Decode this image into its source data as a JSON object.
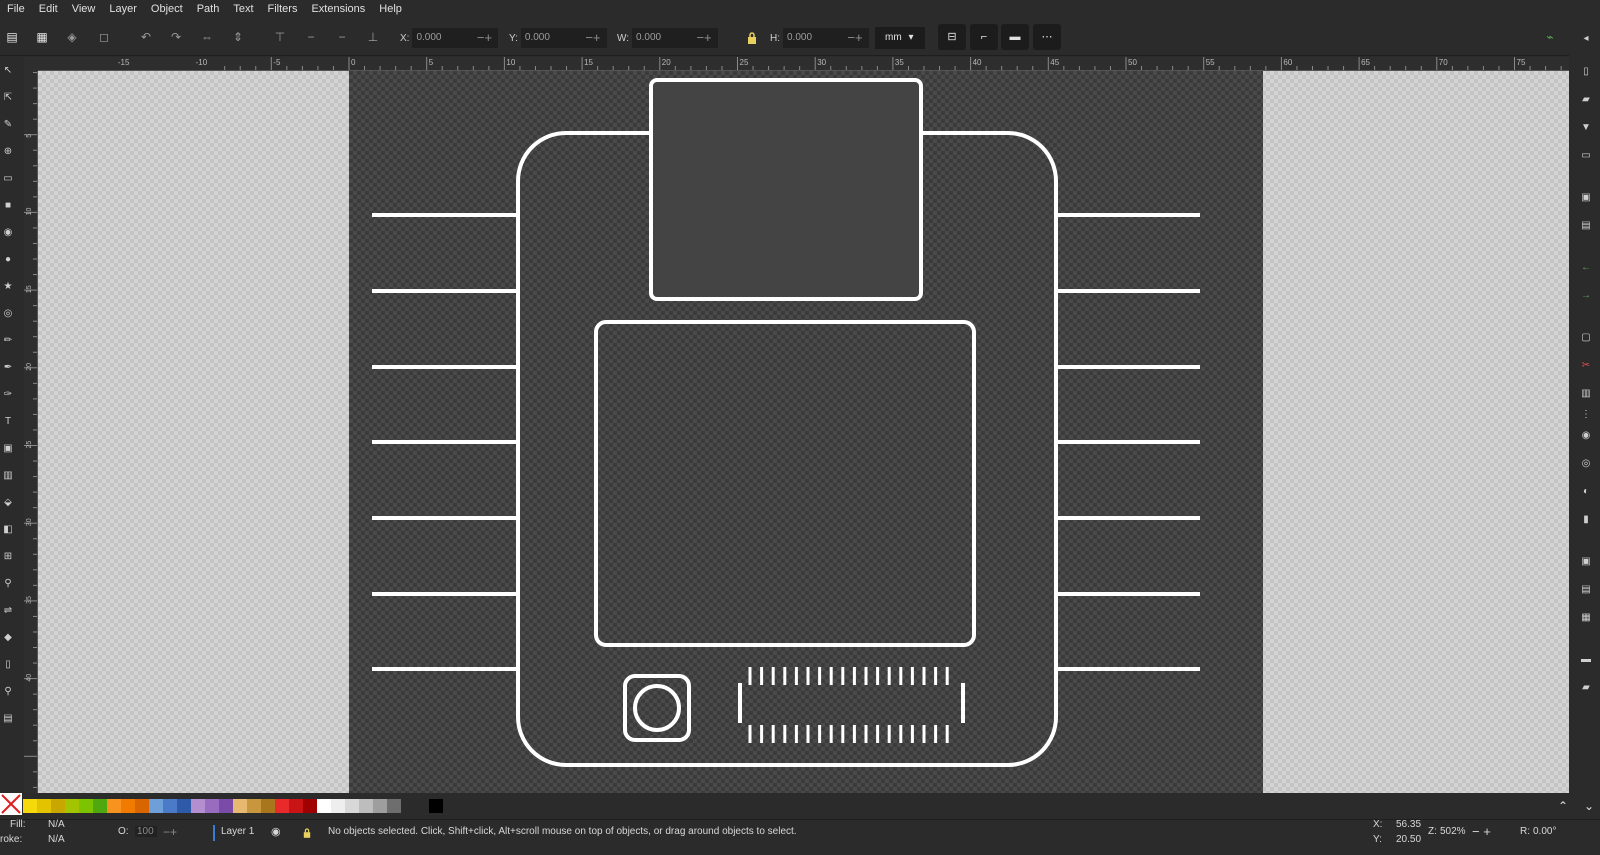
{
  "menu": [
    "File",
    "Edit",
    "View",
    "Layer",
    "Object",
    "Path",
    "Text",
    "Filters",
    "Extensions",
    "Help"
  ],
  "controls": {
    "x_label": "X:",
    "x_value": "0.000",
    "y_label": "Y:",
    "y_value": "0.000",
    "w_label": "W:",
    "w_value": "0.000",
    "h_label": "H:",
    "h_value": "0.000",
    "unit": "mm"
  },
  "ruler": {
    "h_ticks": [
      "-15",
      "-10",
      "-5",
      "0",
      "5",
      "10",
      "15",
      "20",
      "25",
      "30",
      "35",
      "40",
      "45",
      "50",
      "55",
      "60",
      "65",
      "70",
      "75"
    ],
    "v_ticks": [
      "5",
      "10",
      "15",
      "20",
      "25",
      "30",
      "35",
      "40"
    ]
  },
  "palette": {
    "colors": [
      "#f5d90a",
      "#e3c300",
      "#c8a800",
      "#a3c400",
      "#7cc400",
      "#4ea80e",
      "#f7931e",
      "#f07b00",
      "#d86500",
      "#6f9fd8",
      "#4a7ac8",
      "#2f5aa8",
      "#b48fd0",
      "#9a6cbf",
      "#7a4ca8",
      "#e6b870",
      "#c8963c",
      "#a8761c",
      "#e82a2a",
      "#c81414",
      "#a00000",
      "#ffffff",
      "#eeeeee",
      "#d8d8d8",
      "#bdbdbd",
      "#9e9e9e",
      "#6e6e6e",
      "#2b2b2b",
      "#000000"
    ]
  },
  "status": {
    "fill_label": "Fill:",
    "fill_value": "N/A",
    "stroke_label": "roke:",
    "stroke_value": "N/A",
    "opacity_label": "O:",
    "opacity_value": "100",
    "layer": "Layer 1",
    "message": "No objects selected. Click, Shift+click, Alt+scroll mouse on top of objects, or drag around objects to select.",
    "cursor_x_label": "X:",
    "cursor_x": "56.35",
    "cursor_y_label": "Y:",
    "cursor_y": "20.50",
    "zoom_label": "Z:",
    "zoom": "502%",
    "rotate_label": "R:",
    "rotate": "0.00°"
  },
  "colors": {
    "ui_bg": "#2b2b2b",
    "page_bg": "#3b3b3b",
    "stroke": "#ffffff"
  }
}
